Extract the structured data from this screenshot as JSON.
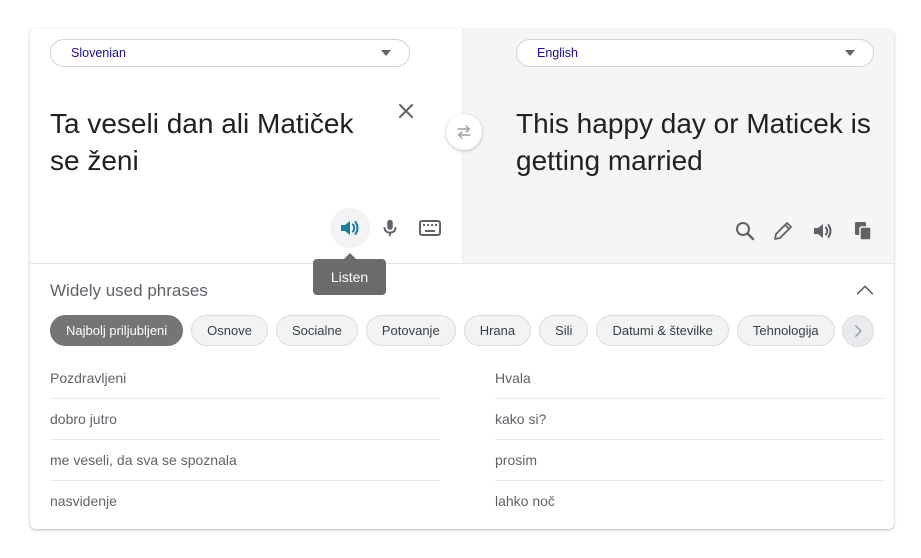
{
  "source": {
    "language": "Slovenian",
    "text": "Ta veseli dan ali Matiček se ženi"
  },
  "target": {
    "language": "English",
    "text": "This happy day or Maticek is getting married"
  },
  "tooltip": {
    "listen": "Listen"
  },
  "phrases": {
    "title": "Widely used phrases",
    "chips": [
      "Najbolj priljubljeni",
      "Osnove",
      "Socialne",
      "Potovanje",
      "Hrana",
      "Sili",
      "Datumi & številke",
      "Tehnologija"
    ],
    "active_chip": 0,
    "left": [
      "Pozdravljeni",
      "dobro jutro",
      "me veseli, da sva se spoznala",
      "nasvidenje"
    ],
    "right": [
      "Hvala",
      "kako si?",
      "prosim",
      "lahko noč"
    ]
  },
  "colors": {
    "accent": "#1a73e8",
    "listen_icon": "#1a7f9c",
    "active_chip": "#757575",
    "icon_gray": "#5f6368"
  },
  "icons": [
    "close-icon",
    "swap-icon",
    "speaker-icon",
    "microphone-icon",
    "keyboard-icon",
    "search-icon",
    "pencil-icon",
    "copy-icon",
    "chevron-up-icon",
    "chevron-right-icon",
    "caret-down-icon"
  ]
}
